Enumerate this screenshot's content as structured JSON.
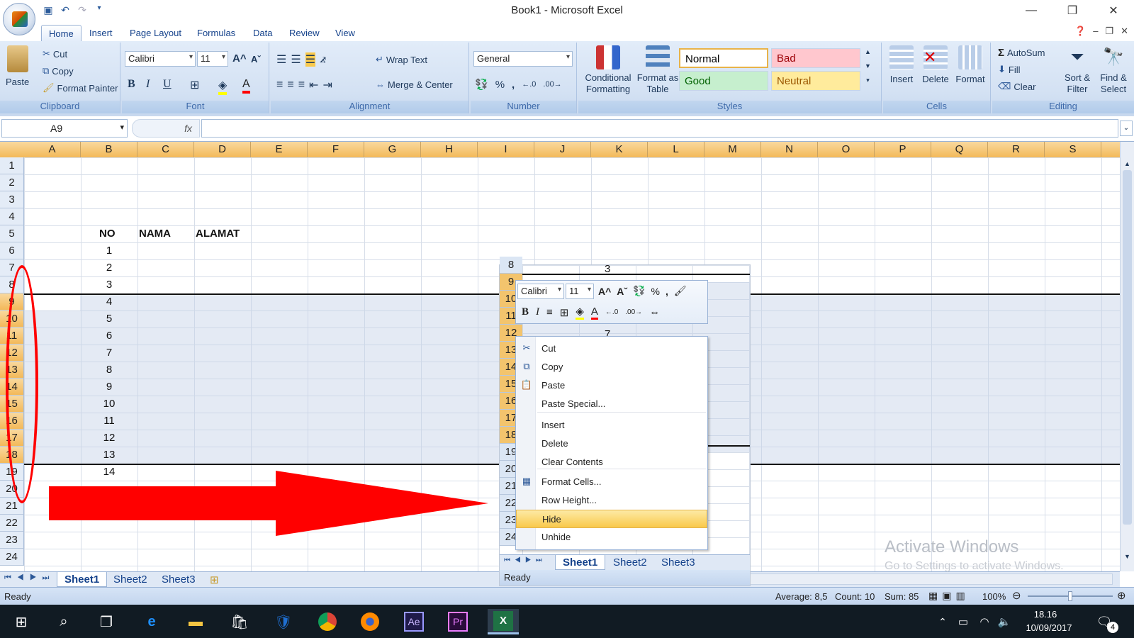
{
  "window": {
    "title": "Book1 - Microsoft Excel",
    "minimize": "—",
    "restore": "❐",
    "close": "✕"
  },
  "tabs": [
    "Home",
    "Insert",
    "Page Layout",
    "Formulas",
    "Data",
    "Review",
    "View"
  ],
  "clipboard": {
    "paste": "Paste",
    "cut": "Cut",
    "copy": "Copy",
    "format_painter": "Format Painter",
    "label": "Clipboard"
  },
  "font": {
    "name": "Calibri",
    "size": "11",
    "label": "Font",
    "bold": "B",
    "italic": "I",
    "underline": "U"
  },
  "alignment": {
    "wrap": "Wrap Text",
    "merge": "Merge & Center",
    "label": "Alignment"
  },
  "number": {
    "format": "General",
    "label": "Number",
    "percent": "%",
    "comma": ","
  },
  "styles": {
    "conditional": "Conditional Formatting",
    "format_table": "Format as Table",
    "normal": "Normal",
    "bad": "Bad",
    "good": "Good",
    "neutral": "Neutral",
    "label": "Styles"
  },
  "cells": {
    "insert": "Insert",
    "delete": "Delete",
    "format": "Format",
    "label": "Cells"
  },
  "editing": {
    "autosum": "AutoSum",
    "fill": "Fill",
    "clear": "Clear",
    "sort": "Sort & Filter",
    "find": "Find & Select",
    "label": "Editing"
  },
  "formula_bar": {
    "name_box": "A9",
    "fx": "fx",
    "content": ""
  },
  "columns": [
    "A",
    "B",
    "C",
    "D",
    "E",
    "F",
    "G",
    "H",
    "I",
    "J",
    "K",
    "L",
    "M",
    "N",
    "O",
    "P",
    "Q",
    "R",
    "S"
  ],
  "rows": [
    "1",
    "2",
    "3",
    "4",
    "5",
    "6",
    "7",
    "8",
    "9",
    "10",
    "11",
    "12",
    "13",
    "14",
    "15",
    "16",
    "17",
    "18",
    "19",
    "20",
    "21",
    "22",
    "23",
    "24"
  ],
  "headers": {
    "no": "NO",
    "nama": "NAMA",
    "alamat": "ALAMAT"
  },
  "numbers": [
    "1",
    "2",
    "3",
    "4",
    "5",
    "6",
    "7",
    "8",
    "9",
    "10",
    "11",
    "12",
    "13",
    "14"
  ],
  "sheets": [
    "Sheet1",
    "Sheet2",
    "Sheet3"
  ],
  "status": {
    "ready": "Ready",
    "average": "Average: 8,5",
    "count": "Count: 10",
    "sum": "Sum: 85",
    "zoom": "100%"
  },
  "overlay": {
    "rows": [
      "8",
      "9",
      "10",
      "11",
      "12",
      "13",
      "14",
      "15",
      "16",
      "17",
      "18",
      "19",
      "20",
      "21",
      "22",
      "23",
      "24"
    ],
    "values": [
      "3",
      "7"
    ],
    "sheets": [
      "Sheet1",
      "Sheet2",
      "Sheet3"
    ],
    "ready": "Ready",
    "font": "Calibri",
    "size": "11"
  },
  "context_menu": [
    "Cut",
    "Copy",
    "Paste",
    "Paste Special...",
    "Insert",
    "Delete",
    "Clear Contents",
    "Format Cells...",
    "Row Height...",
    "Hide",
    "Unhide"
  ],
  "watermark": {
    "line1": "Activate Windows",
    "line2": "Go to Settings to activate Windows."
  },
  "taskbar": {
    "time": "18.16",
    "date": "10/09/2017",
    "notifications": "4"
  },
  "colors": {
    "annotation": "#ff0000",
    "highlight": "#f9c94b"
  }
}
